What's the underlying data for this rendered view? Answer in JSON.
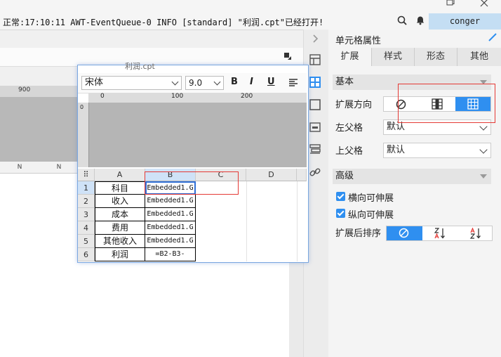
{
  "status_bar": {
    "message": "正常:17:10:11 AWT-EventQueue-0 INFO [standard] \"利润.cpt\"已经打开!",
    "user": "conger"
  },
  "background": {
    "ruler_label": "900",
    "col_headers": [
      "N",
      "N"
    ]
  },
  "floating_window": {
    "title": "利润.cpt",
    "font_name": "宋体",
    "font_size": "9.0",
    "bold_label": "B",
    "italic_label": "I",
    "underline_label": "U",
    "ruler_marks": [
      "0",
      "100",
      "200"
    ],
    "left_ruler_mark": "0",
    "columns": [
      "A",
      "B",
      "C",
      "D"
    ],
    "rows": [
      {
        "num": "1",
        "a": "科目",
        "b": "Embedded1.G"
      },
      {
        "num": "2",
        "a": "收入",
        "b": "Embedded1.G"
      },
      {
        "num": "3",
        "a": "成本",
        "b": "Embedded1.G"
      },
      {
        "num": "4",
        "a": "费用",
        "b": "Embedded1.G"
      },
      {
        "num": "5",
        "a": "其他收入",
        "b": "Embedded1.G"
      },
      {
        "num": "6",
        "a": "利润",
        "b": "=B2-B3-"
      }
    ]
  },
  "panel": {
    "title": "单元格属性",
    "tabs": [
      "扩展",
      "样式",
      "形态",
      "其他"
    ],
    "basic_section": "基本",
    "expand_direction_label": "扩展方向",
    "left_parent_label": "左父格",
    "left_parent_value": "默认",
    "top_parent_label": "上父格",
    "top_parent_value": "默认",
    "advanced_section": "高级",
    "horizontal_expand": "横向可伸展",
    "vertical_expand": "纵向可伸展",
    "sort_label": "扩展后排序"
  },
  "colors": {
    "accent": "#2f8ff0",
    "annotation": "#e53935",
    "user_box": "#c4def3"
  }
}
